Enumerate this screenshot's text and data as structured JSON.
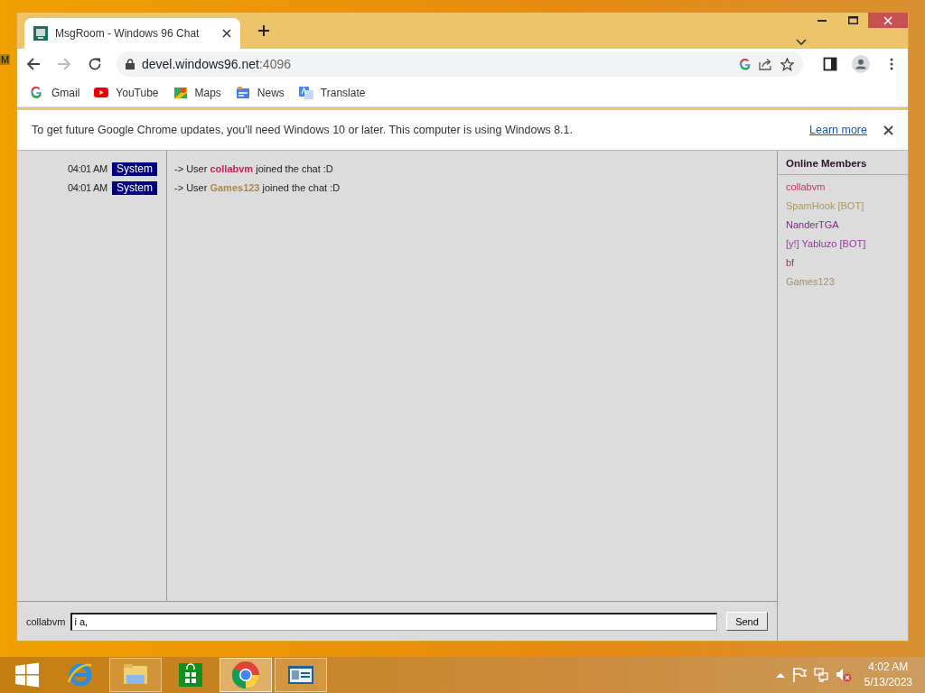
{
  "desktop": {
    "icon_label": "M"
  },
  "browser": {
    "tabs": [
      {
        "title": "MsgRoom - Windows 96 Chat",
        "selected": true
      }
    ],
    "address": {
      "host": "devel.windows96.net",
      "port": ":4096"
    },
    "bookmarks": [
      {
        "label": "Gmail",
        "kind": "gmail"
      },
      {
        "label": "YouTube",
        "kind": "youtube"
      },
      {
        "label": "Maps",
        "kind": "maps"
      },
      {
        "label": "News",
        "kind": "news"
      },
      {
        "label": "Translate",
        "kind": "translate"
      }
    ],
    "infobar": {
      "message": "To get future Google Chrome updates, you'll need Windows 10 or later. This computer is using Windows 8.1.",
      "link": "Learn more"
    }
  },
  "chat": {
    "messages": [
      {
        "time": "04:01 AM",
        "sender": "System",
        "prefix": "-> User",
        "user": "collabvm",
        "color": "#cc2255",
        "suffix": "joined the chat :D"
      },
      {
        "time": "04:01 AM",
        "sender": "System",
        "prefix": "-> User",
        "user": "Games123",
        "color": "#a88a50",
        "suffix": "joined the chat :D"
      }
    ],
    "members_title": "Online Members",
    "members": [
      {
        "name": "collabvm",
        "color": "#cc3355"
      },
      {
        "name": "SpamHook [BOT]",
        "color": "#a89a60"
      },
      {
        "name": "NanderTGA",
        "color": "#7a2a80"
      },
      {
        "name": "[y!] Yabluzo [BOT]",
        "color": "#a030a8"
      },
      {
        "name": "bf",
        "color": "#b83040"
      },
      {
        "name": "Games123",
        "color": "#a09070"
      }
    ],
    "nickname": "collabvm",
    "input": {
      "value": "i a,"
    },
    "send_label": "Send"
  },
  "taskbar": {
    "apps": [
      {
        "kind": "ie",
        "running": false,
        "selected": false
      },
      {
        "kind": "explorer",
        "running": true,
        "selected": false
      },
      {
        "kind": "store",
        "running": false,
        "selected": false
      },
      {
        "kind": "chrome",
        "running": true,
        "selected": true
      },
      {
        "kind": "app",
        "running": true,
        "selected": false
      }
    ],
    "clock": {
      "time": "4:02 AM",
      "date": "5/13/2023"
    }
  }
}
